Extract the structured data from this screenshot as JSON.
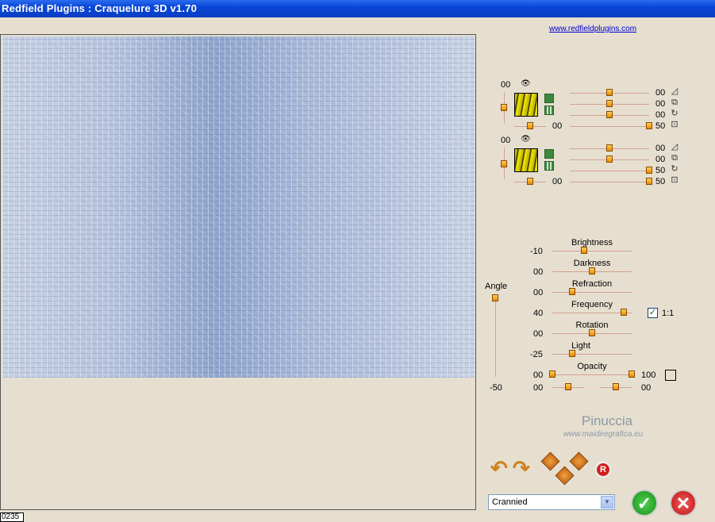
{
  "window": {
    "title": "Redfield Plugins : Craquelure 3D  v1.70"
  },
  "site_link": "www.redfieldplugins.com",
  "status": "0235",
  "layers": [
    {
      "left_value": "00",
      "row_values": [
        "00",
        "00",
        "00",
        "50"
      ],
      "bottom_value": "00"
    },
    {
      "left_value": "00",
      "row_values": [
        "00",
        "00",
        "50",
        "50"
      ],
      "bottom_value": "00"
    }
  ],
  "angle": {
    "label": "Angle",
    "value": "-50"
  },
  "params": [
    {
      "label": "Brightness",
      "value": "-10"
    },
    {
      "label": "Darkness",
      "value": "00"
    },
    {
      "label": "Refraction",
      "value": "00"
    },
    {
      "label": "Frequency",
      "value": "40"
    },
    {
      "label": "Rotation",
      "value": "00"
    },
    {
      "label": "Light",
      "value": "-25"
    }
  ],
  "ratio_checkbox": {
    "label": "1:1",
    "checked": true
  },
  "opacity": {
    "label": "Opacity",
    "min": "00",
    "max": "100"
  },
  "extra": {
    "left": "00",
    "right": "00"
  },
  "branding": {
    "name": "Pinuccia",
    "url": "www.maidiregrafica.eu"
  },
  "preset": {
    "selected": "Crannied"
  },
  "icons": {
    "eye": "eye-icon",
    "undo": "undo-arrow-icon",
    "redo": "redo-arrow-icon",
    "randomize": "dice-icon",
    "reset": "reset-icon",
    "ok": "checkmark-icon",
    "cancel": "x-icon"
  },
  "reset_label": "R"
}
